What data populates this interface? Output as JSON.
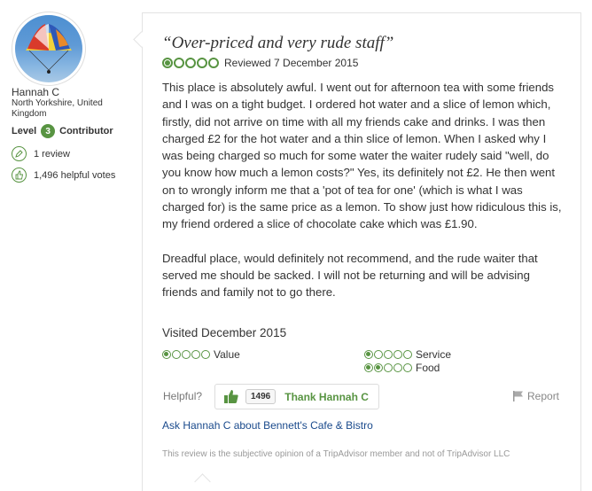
{
  "reviewer": {
    "name": "Hannah C",
    "location": "North Yorkshire, United Kingdom",
    "level_prefix": "Level",
    "level": "3",
    "level_suffix": "Contributor",
    "reviews": "1 review",
    "helpful_votes": "1,496 helpful votes",
    "avatar_icon": "parasailing-photo"
  },
  "review": {
    "title": "“Over-priced and very rude staff”",
    "rating": 1,
    "rating_max": 5,
    "reviewed_date": "Reviewed 7 December 2015",
    "paragraph1": "This place is absolutely awful. I went out for afternoon tea with some friends and I was on a tight budget. I ordered hot water and a slice of lemon which, firstly, did not arrive on time with all my friends cake and drinks. I was then charged £2 for the hot water and a thin slice of lemon. When I asked why I was being charged so much for some water the waiter rudely said \"well, do you know how much a lemon costs?\" Yes, its definitely not £2. He then went on to wrongly inform me that a 'pot of tea for one' (which is what I was charged for) is the same price as a lemon. To show just how ridiculous this is, my friend ordered a slice of chocolate cake which was £1.90.",
    "paragraph2": "Dreadful place, would definitely not recommend, and the rude waiter that served me should be sacked. I will not be returning and will be advising friends and family not to go there.",
    "visited": "Visited December 2015",
    "sub_ratings": [
      {
        "label": "Value",
        "rating": 1
      },
      {
        "label": "Service",
        "rating": 1
      },
      {
        "label": "Food",
        "rating": 2
      }
    ]
  },
  "actions": {
    "helpful_label": "Helpful?",
    "thank_count": "1496",
    "thank_label": "Thank Hannah C",
    "report_label": "Report",
    "ask_link": "Ask Hannah C about Bennett's Cafe & Bistro",
    "disclaimer": "This review is the subjective opinion of a TripAdvisor member and not of TripAdvisor LLC"
  },
  "colors": {
    "accent_green": "#589442",
    "link_blue": "#1a4a8c"
  }
}
